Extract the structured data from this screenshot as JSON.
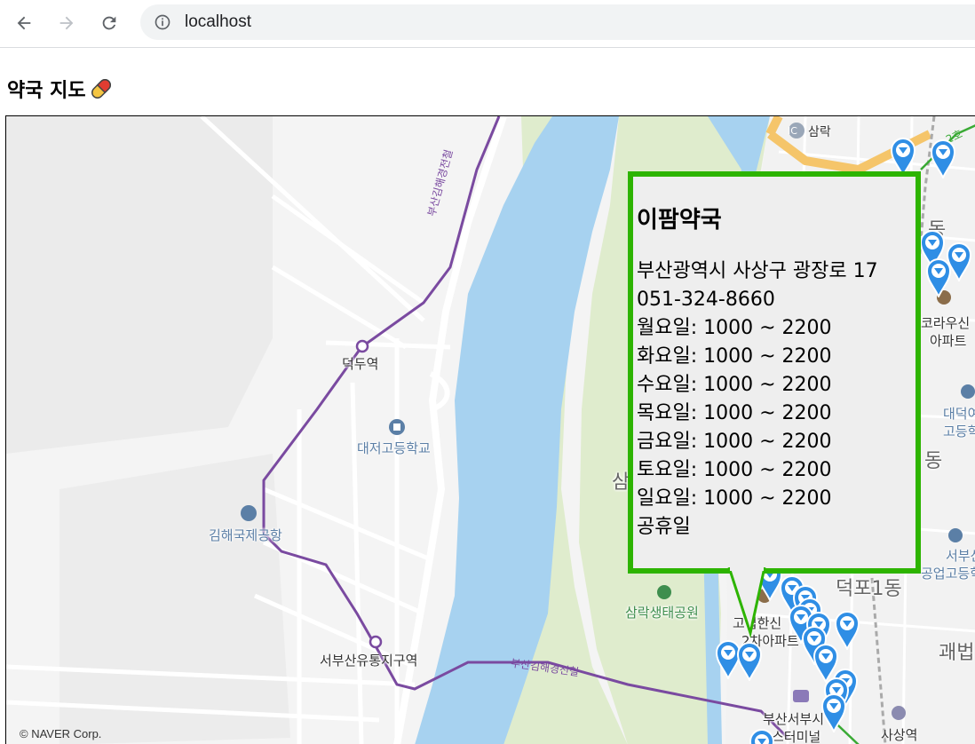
{
  "browser": {
    "url": "localhost"
  },
  "page": {
    "title": "약국 지도"
  },
  "map": {
    "copyright": "© NAVER Corp.",
    "labels": {
      "deokdu_station": "덕두역",
      "daejeo_high": "대저고등학교",
      "gimhae_airport": "김해국제공항",
      "seobusan_logistics": "서부산유통지구역",
      "samrak_ic": "삼락",
      "ic_badge": "IC",
      "samrak_park": "삼락생태공원",
      "deokpo1dong": "덕포1동",
      "gwaebeop": "괘법",
      "sasang_station": "사상역",
      "bus_terminal_1": "부산서부시",
      "bus_terminal_2": "스터미널",
      "apt_1": "고법한신",
      "apt_2": "2차아파트",
      "korausin_1": "코라우신",
      "korausin_2": "아파트",
      "daedeok_1": "대덕여",
      "daedeok_2": "고등학",
      "seobusan_tech_1": "서부산",
      "seobusan_tech_2": "공업고등학",
      "dong_1": "동",
      "dong_2": "동",
      "sam_char": "삼",
      "rail_label_1": "부산김해경전철",
      "rail_label_2": "부산김해경전철",
      "line2": "2호"
    },
    "infowindow": {
      "name": "이팜약국",
      "address": "부산광역시 사상구 광장로 17",
      "phone": "051-324-8660",
      "hours": [
        "월요일: 1000 ~ 2200",
        "화요일: 1000 ~ 2200",
        "수요일: 1000 ~ 2200",
        "목요일: 1000 ~ 2200",
        "금요일: 1000 ~ 2200",
        "토요일: 1000 ~ 2200",
        "일요일: 1000 ~ 2200"
      ],
      "holiday": "공휴일"
    },
    "colors": {
      "marker": "#2f8ee5",
      "infowindow_border": "#2db400",
      "river": "#a7d2f0",
      "park": "#dfeccd",
      "rail": "#7a4aa0"
    }
  }
}
